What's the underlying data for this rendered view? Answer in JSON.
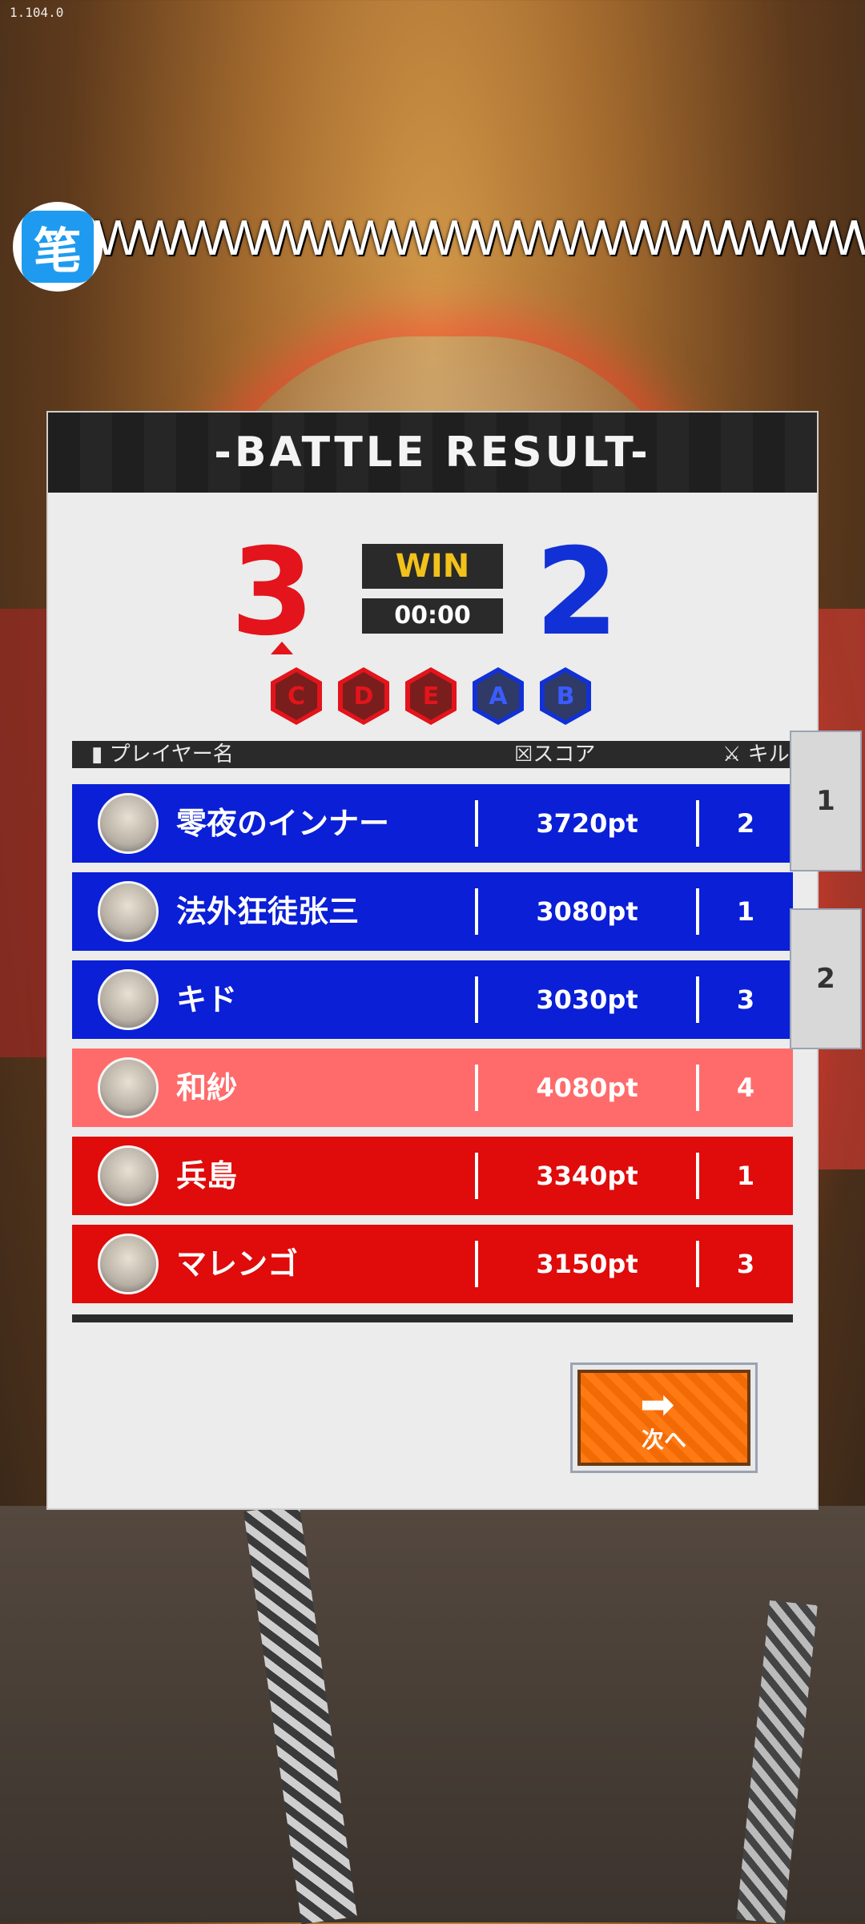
{
  "status": {
    "version": "1.104.0"
  },
  "danmaku": {
    "avatar_char": "笔",
    "text": "WWWWWWWWWWWWWWWWWWWWWWWW"
  },
  "result": {
    "title": "-BATTLE RESULT-",
    "score_left": "3",
    "score_right": "2",
    "outcome": "WIN",
    "time": "00:00",
    "points": [
      {
        "label": "C",
        "team": "red"
      },
      {
        "label": "D",
        "team": "red"
      },
      {
        "label": "E",
        "team": "red"
      },
      {
        "label": "A",
        "team": "blue"
      },
      {
        "label": "B",
        "team": "blue"
      }
    ],
    "columns": {
      "player": "プレイヤー名",
      "score": "スコア",
      "kill": "キル"
    },
    "players": [
      {
        "name": "零夜のインナー",
        "score": "3720pt",
        "kills": "2",
        "team": "blue"
      },
      {
        "name": "法外狂徒张三",
        "score": "3080pt",
        "kills": "1",
        "team": "blue"
      },
      {
        "name": "キド",
        "score": "3030pt",
        "kills": "3",
        "team": "blue"
      },
      {
        "name": "和紗",
        "score": "4080pt",
        "kills": "4",
        "team": "me"
      },
      {
        "name": "兵島",
        "score": "3340pt",
        "kills": "1",
        "team": "red"
      },
      {
        "name": "マレンゴ",
        "score": "3150pt",
        "kills": "3",
        "team": "red"
      }
    ],
    "next_label": "次へ",
    "team_tabs": [
      "1",
      "2"
    ]
  },
  "colors": {
    "red_team": "#e00b0b",
    "blue_team": "#0a1fd6",
    "highlight_row": "#ff6b6b",
    "win": "#f2c21b",
    "next_button": "#ff7a12"
  }
}
